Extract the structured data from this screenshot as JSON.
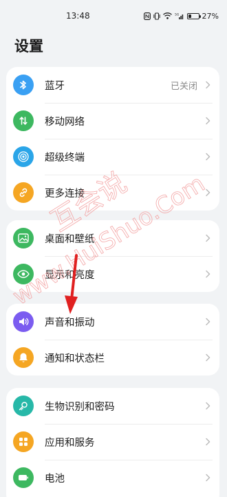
{
  "status_bar": {
    "time": "13:48",
    "battery_percent": "27%",
    "battery_level": 0.27,
    "network_badge": "5G"
  },
  "page": {
    "title": "设置"
  },
  "groups": [
    {
      "items": [
        {
          "label": "蓝牙",
          "value": "已关闭",
          "icon": "bluetooth-icon",
          "color": "#3aa0f3"
        },
        {
          "label": "移动网络",
          "icon": "mobile-network-icon",
          "color": "#3db860"
        },
        {
          "label": "超级终端",
          "icon": "super-device-icon",
          "color": "#2aa5e8"
        },
        {
          "label": "更多连接",
          "icon": "link-icon",
          "color": "#f5a623"
        }
      ]
    },
    {
      "items": [
        {
          "label": "桌面和壁纸",
          "icon": "wallpaper-icon",
          "color": "#3db860"
        },
        {
          "label": "显示和亮度",
          "icon": "eye-icon",
          "color": "#3db860"
        }
      ]
    },
    {
      "items": [
        {
          "label": "声音和振动",
          "icon": "sound-icon",
          "color": "#7b5cf0"
        },
        {
          "label": "通知和状态栏",
          "icon": "bell-icon",
          "color": "#f5a623"
        }
      ]
    },
    {
      "items": [
        {
          "label": "生物识别和密码",
          "icon": "key-icon",
          "color": "#27b8a8"
        },
        {
          "label": "应用和服务",
          "icon": "apps-icon",
          "color": "#f5a623"
        },
        {
          "label": "电池",
          "icon": "battery-icon",
          "color": "#3db860"
        }
      ]
    }
  ],
  "watermark": {
    "line1": "互会说",
    "line2": "www.HuiShuo.Com"
  },
  "annotation": {
    "arrow_color": "#e02020"
  }
}
